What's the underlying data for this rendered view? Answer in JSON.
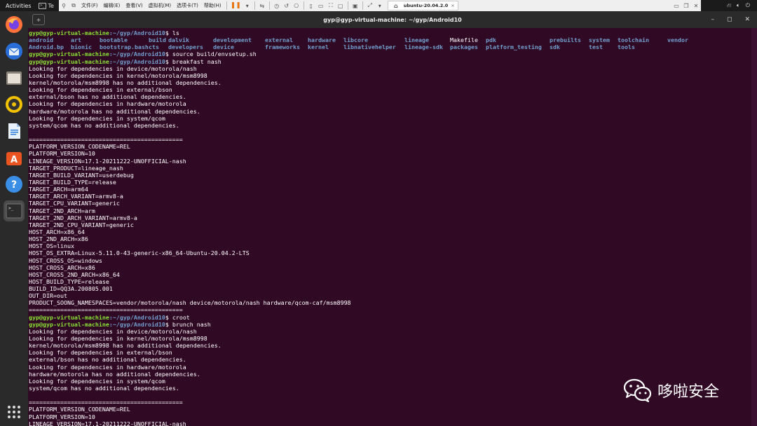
{
  "topbar": {
    "activities": "Activities",
    "terminal_app": "Te",
    "vm_menus": [
      "文件(F)",
      "编辑(E)",
      "查看(V)",
      "虚拟机(M)",
      "选项卡(T)",
      "帮助(H)"
    ],
    "vm_tab": "ubuntu-20.04.2.0",
    "vm_tab_close": "×"
  },
  "window": {
    "title": "gyp@gyp-virtual-machine: ~/gyp/Android10",
    "controls": {
      "minimize": "–",
      "maximize": "◻",
      "close": "✕"
    }
  },
  "dock": {
    "apps": [
      {
        "name": "firefox-icon",
        "color": "#ff7139"
      },
      {
        "name": "thunderbird-icon",
        "color": "#2a6fd8"
      },
      {
        "name": "files-icon",
        "color": "#d8d2c8"
      },
      {
        "name": "rhythmbox-icon",
        "color": "#e6b800"
      },
      {
        "name": "libreoffice-writer-icon",
        "color": "#2a7fd6"
      },
      {
        "name": "software-center-icon",
        "color": "#e95420"
      },
      {
        "name": "help-icon",
        "color": "#3a8ee6"
      },
      {
        "name": "terminal-icon",
        "color": "#2c2c2c"
      }
    ]
  },
  "terminal": {
    "prompt_user": "gyp@gyp-virtual-machine",
    "prompt_path": ":~/gyp/Android10",
    "prompt_suffix": "$ ",
    "ls_rows": [
      [
        {
          "t": "android",
          "k": "dir"
        },
        {
          "t": "art",
          "k": "dir"
        },
        {
          "t": "bootable",
          "k": "dir"
        },
        {
          "t": "build",
          "k": "dir"
        },
        {
          "t": "dalvik",
          "k": "dir"
        },
        {
          "t": "development",
          "k": "dir"
        },
        {
          "t": "external",
          "k": "dir"
        },
        {
          "t": "hardware",
          "k": "dir"
        },
        {
          "t": "libcore",
          "k": "dir"
        },
        {
          "t": "lineage",
          "k": "dir"
        },
        {
          "t": "Makefile",
          "k": "file"
        },
        {
          "t": "pdk",
          "k": "dir"
        },
        {
          "t": "prebuilts",
          "k": "dir"
        },
        {
          "t": "system",
          "k": "dir"
        },
        {
          "t": "toolchain",
          "k": "dir"
        },
        {
          "t": "vendor",
          "k": "dir"
        }
      ],
      [
        {
          "t": "Android.bp",
          "k": "dir"
        },
        {
          "t": "bionic",
          "k": "dir"
        },
        {
          "t": "bootstrap.bash",
          "k": "dir"
        },
        {
          "t": "cts",
          "k": "dir"
        },
        {
          "t": "developers",
          "k": "dir"
        },
        {
          "t": "device",
          "k": "dir"
        },
        {
          "t": "frameworks",
          "k": "dir"
        },
        {
          "t": "kernel",
          "k": "dir"
        },
        {
          "t": "libnativehelper",
          "k": "dir"
        },
        {
          "t": "lineage-sdk",
          "k": "dir"
        },
        {
          "t": "packages",
          "k": "dir"
        },
        {
          "t": "platform_testing",
          "k": "dir"
        },
        {
          "t": "sdk",
          "k": "dir"
        },
        {
          "t": "test",
          "k": "dir"
        },
        {
          "t": "tools",
          "k": "dir"
        },
        {
          "t": "",
          "k": "dir"
        }
      ]
    ],
    "lines": [
      {
        "type": "prompt",
        "cmd": "ls"
      },
      {
        "type": "ls",
        "row": 0
      },
      {
        "type": "ls",
        "row": 1
      },
      {
        "type": "prompt",
        "cmd": "source build/envsetup.sh"
      },
      {
        "type": "prompt",
        "cmd": "breakfast nash"
      },
      {
        "type": "out",
        "text": "Looking for dependencies in device/motorola/nash"
      },
      {
        "type": "out",
        "text": "Looking for dependencies in kernel/motorola/msm8998"
      },
      {
        "type": "out",
        "text": "kernel/motorola/msm8998 has no additional dependencies."
      },
      {
        "type": "out",
        "text": "Looking for dependencies in external/bson"
      },
      {
        "type": "out",
        "text": "external/bson has no additional dependencies."
      },
      {
        "type": "out",
        "text": "Looking for dependencies in hardware/motorola"
      },
      {
        "type": "out",
        "text": "hardware/motorola has no additional dependencies."
      },
      {
        "type": "out",
        "text": "Looking for dependencies in system/qcom"
      },
      {
        "type": "out",
        "text": "system/qcom has no additional dependencies."
      },
      {
        "type": "out",
        "text": ""
      },
      {
        "type": "out",
        "text": "============================================"
      },
      {
        "type": "out",
        "text": "PLATFORM_VERSION_CODENAME=REL"
      },
      {
        "type": "out",
        "text": "PLATFORM_VERSION=10"
      },
      {
        "type": "out",
        "text": "LINEAGE_VERSION=17.1-20211222-UNOFFICIAL-nash"
      },
      {
        "type": "out",
        "text": "TARGET_PRODUCT=lineage_nash"
      },
      {
        "type": "out",
        "text": "TARGET_BUILD_VARIANT=userdebug"
      },
      {
        "type": "out",
        "text": "TARGET_BUILD_TYPE=release"
      },
      {
        "type": "out",
        "text": "TARGET_ARCH=arm64"
      },
      {
        "type": "out",
        "text": "TARGET_ARCH_VARIANT=armv8-a"
      },
      {
        "type": "out",
        "text": "TARGET_CPU_VARIANT=generic"
      },
      {
        "type": "out",
        "text": "TARGET_2ND_ARCH=arm"
      },
      {
        "type": "out",
        "text": "TARGET_2ND_ARCH_VARIANT=armv8-a"
      },
      {
        "type": "out",
        "text": "TARGET_2ND_CPU_VARIANT=generic"
      },
      {
        "type": "out",
        "text": "HOST_ARCH=x86_64"
      },
      {
        "type": "out",
        "text": "HOST_2ND_ARCH=x86"
      },
      {
        "type": "out",
        "text": "HOST_OS=linux"
      },
      {
        "type": "out",
        "text": "HOST_OS_EXTRA=Linux-5.11.0-43-generic-x86_64-Ubuntu-20.04.2-LTS"
      },
      {
        "type": "out",
        "text": "HOST_CROSS_OS=windows"
      },
      {
        "type": "out",
        "text": "HOST_CROSS_ARCH=x86"
      },
      {
        "type": "out",
        "text": "HOST_CROSS_2ND_ARCH=x86_64"
      },
      {
        "type": "out",
        "text": "HOST_BUILD_TYPE=release"
      },
      {
        "type": "out",
        "text": "BUILD_ID=QQ3A.200805.001"
      },
      {
        "type": "out",
        "text": "OUT_DIR=out"
      },
      {
        "type": "out",
        "text": "PRODUCT_SOONG_NAMESPACES=vendor/motorola/nash device/motorola/nash hardware/qcom-caf/msm8998"
      },
      {
        "type": "out",
        "text": "============================================"
      },
      {
        "type": "prompt",
        "cmd": "croot"
      },
      {
        "type": "prompt",
        "cmd": "brunch nash"
      },
      {
        "type": "out",
        "text": "Looking for dependencies in device/motorola/nash"
      },
      {
        "type": "out",
        "text": "Looking for dependencies in kernel/motorola/msm8998"
      },
      {
        "type": "out",
        "text": "kernel/motorola/msm8998 has no additional dependencies."
      },
      {
        "type": "out",
        "text": "Looking for dependencies in external/bson"
      },
      {
        "type": "out",
        "text": "external/bson has no additional dependencies."
      },
      {
        "type": "out",
        "text": "Looking for dependencies in hardware/motorola"
      },
      {
        "type": "out",
        "text": "hardware/motorola has no additional dependencies."
      },
      {
        "type": "out",
        "text": "Looking for dependencies in system/qcom"
      },
      {
        "type": "out",
        "text": "system/qcom has no additional dependencies."
      },
      {
        "type": "out",
        "text": ""
      },
      {
        "type": "out",
        "text": "============================================"
      },
      {
        "type": "out",
        "text": "PLATFORM_VERSION_CODENAME=REL"
      },
      {
        "type": "out",
        "text": "PLATFORM_VERSION=10"
      },
      {
        "type": "out",
        "text": "LINEAGE_VERSION=17.1-20211222-UNOFFICIAL-nash"
      }
    ]
  },
  "watermark": {
    "text": "哆啦安全"
  }
}
